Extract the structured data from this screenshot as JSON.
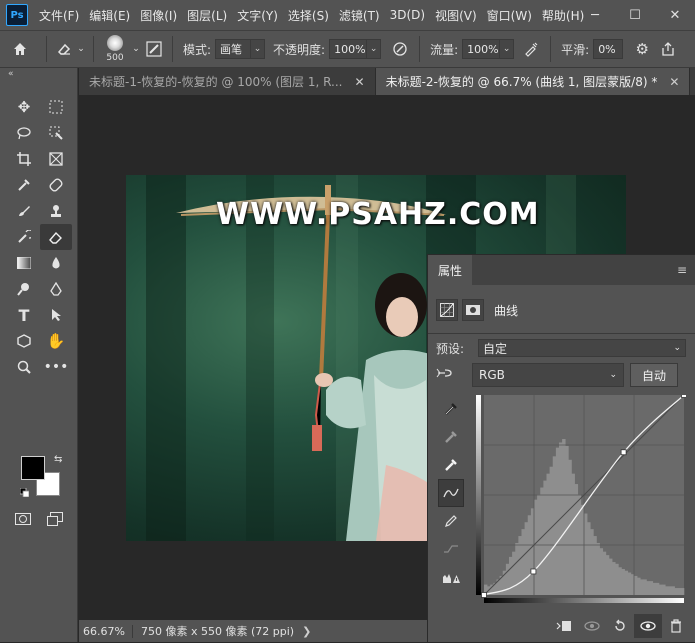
{
  "app": {
    "logo": "Ps",
    "menus": [
      "文件(F)",
      "编辑(E)",
      "图像(I)",
      "图层(L)",
      "文字(Y)",
      "选择(S)",
      "滤镜(T)",
      "3D(D)",
      "视图(V)",
      "窗口(W)",
      "帮助(H)"
    ],
    "window_controls": [
      "─",
      "☐",
      "✕"
    ]
  },
  "options_bar": {
    "brush_size": "500",
    "mode_label": "模式:",
    "mode_value": "画笔",
    "opacity_label": "不透明度:",
    "opacity_value": "100%",
    "flow_label": "流量:",
    "flow_value": "100%",
    "smoothing_label": "平滑:",
    "smoothing_value": "0%"
  },
  "tabs": [
    {
      "title": "未标题-1-恢复的-恢复的 @ 100% (图层 1, R...",
      "active": false
    },
    {
      "title": "未标题-2-恢复的 @ 66.7% (曲线 1, 图层蒙版/8) *",
      "active": true
    }
  ],
  "canvas": {
    "watermark": "WWW.PSAHZ.COM"
  },
  "status": {
    "zoom": "66.67%",
    "info": "750 像素 x 550 像素 (72 ppi)",
    "arrow": "❯"
  },
  "properties": {
    "tab_label": "属性",
    "adjustment_label": "曲线",
    "preset_label": "预设:",
    "preset_value": "自定",
    "channel_value": "RGB",
    "auto_label": "自动"
  },
  "curve": {
    "points": [
      [
        0,
        0
      ],
      [
        63,
        30
      ],
      [
        178,
        182
      ],
      [
        255,
        255
      ]
    ],
    "histogram": [
      6,
      5,
      6,
      7,
      9,
      11,
      14,
      18,
      22,
      25,
      30,
      34,
      38,
      42,
      46,
      50,
      55,
      58,
      62,
      66,
      70,
      74,
      80,
      85,
      88,
      90,
      86,
      78,
      70,
      64,
      58,
      52,
      47,
      42,
      38,
      34,
      30,
      27,
      25,
      23,
      21,
      19,
      18,
      16,
      15,
      14,
      13,
      12,
      11,
      10,
      9,
      9,
      8,
      8,
      7,
      7,
      6,
      6,
      5,
      5,
      5,
      4,
      4,
      4
    ]
  },
  "colors": {
    "accent": "#31a8ff",
    "ui_dark": "#535353",
    "canvas_bg": "#282828"
  }
}
